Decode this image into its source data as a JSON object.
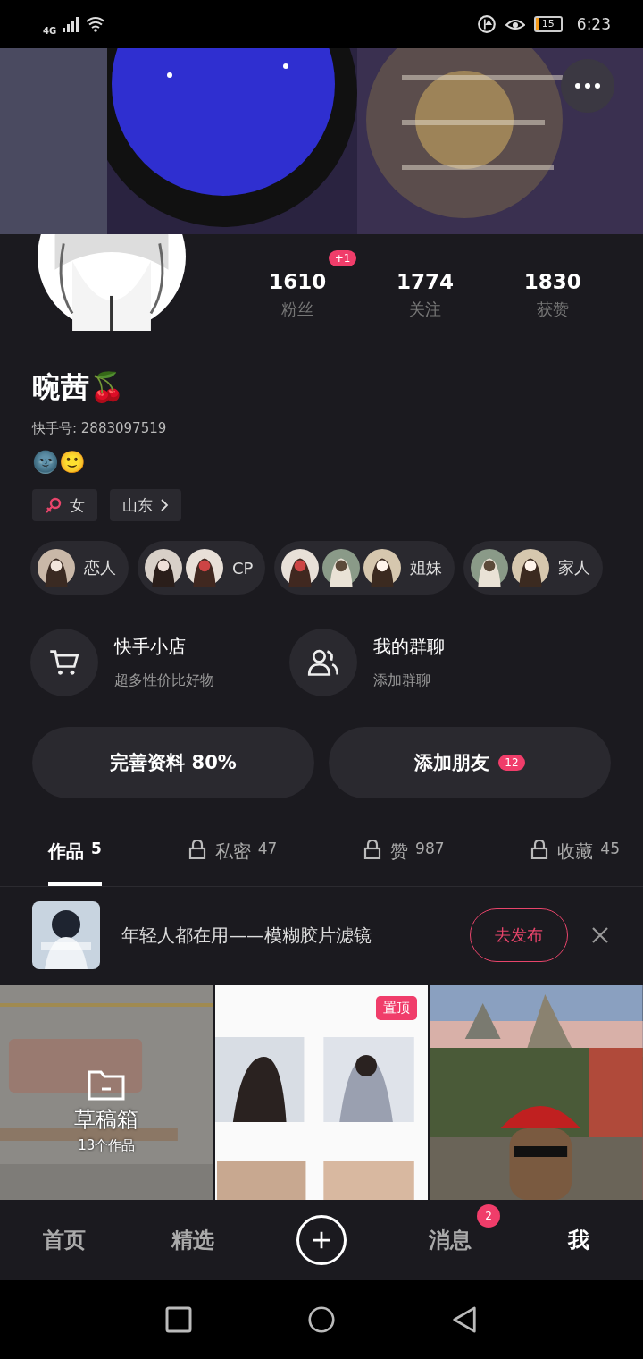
{
  "status_bar": {
    "network": "4G",
    "battery": "15",
    "time": "6:23"
  },
  "profile": {
    "name": "晼茜🍒",
    "user_id": "快手号: 2883097519",
    "signature": "🌚🙂",
    "stats": [
      {
        "value": "1610",
        "label": "粉丝",
        "badge": "+1"
      },
      {
        "value": "1774",
        "label": "关注"
      },
      {
        "value": "1830",
        "label": "获赞"
      }
    ],
    "tags": [
      {
        "kind": "gender",
        "text": "女"
      },
      {
        "kind": "location",
        "text": "山东"
      }
    ]
  },
  "relations": [
    {
      "label": "恋人"
    },
    {
      "label": "CP"
    },
    {
      "label": "姐妹"
    },
    {
      "label": "家人"
    }
  ],
  "services": [
    {
      "kind": "cart",
      "title": "快手小店",
      "subtitle": "超多性价比好物"
    },
    {
      "kind": "group",
      "title": "我的群聊",
      "subtitle": "添加群聊"
    }
  ],
  "actions": [
    {
      "label": "完善资料 80%"
    },
    {
      "label": "添加朋友",
      "badge": "12"
    }
  ],
  "tabs": [
    {
      "label": "作品",
      "count": "5",
      "selected": true,
      "locked": false
    },
    {
      "label": "私密",
      "count": "47",
      "selected": false,
      "locked": true
    },
    {
      "label": "赞",
      "count": "987",
      "selected": false,
      "locked": true
    },
    {
      "label": "收藏",
      "count": "45",
      "selected": false,
      "locked": true
    }
  ],
  "promo": {
    "text": "年轻人都在用——模糊胶片滤镜",
    "button": "去发布"
  },
  "grid": [
    {
      "kind": "drafts",
      "title": "草稿箱",
      "subtitle": "13个作品"
    },
    {
      "kind": "pinned",
      "badge": "置顶"
    },
    {
      "kind": "video"
    }
  ],
  "bottom_nav": [
    {
      "kind": "tab",
      "label": "首页",
      "selected": false
    },
    {
      "kind": "tab",
      "label": "精选",
      "selected": false
    },
    {
      "kind": "create"
    },
    {
      "kind": "tab",
      "label": "消息",
      "selected": false,
      "badge": "2"
    },
    {
      "kind": "tab",
      "label": "我",
      "selected": true
    }
  ]
}
